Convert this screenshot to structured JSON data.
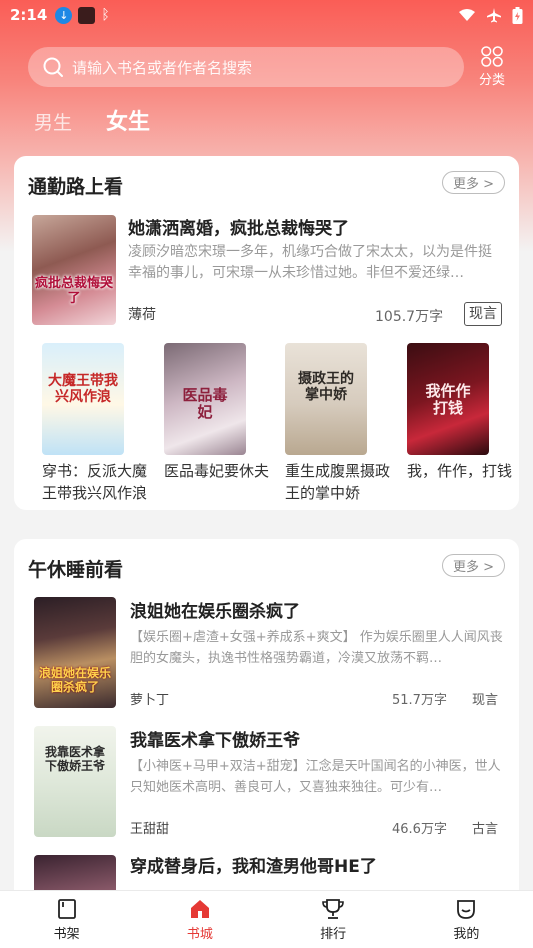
{
  "status_bar": {
    "time": "2:14"
  },
  "search": {
    "placeholder": "请输入书名或者作者名搜索"
  },
  "category": {
    "label": "分类"
  },
  "gender_tabs": [
    {
      "label": "男生"
    },
    {
      "label": "女生"
    }
  ],
  "sections": [
    {
      "title": "通勤路上看",
      "more": "更多 >",
      "featured": {
        "title": "她潇洒离婚，疯批总裁悔哭了",
        "description": "凌顾汐暗恋宋璟一多年，机缘巧合做了宋太太，以为是件挺幸福的事儿，可宋璟一从未珍惜过她。非但不爱还绿…",
        "author": "薄荷",
        "words": "105.7万字",
        "tag": "现言",
        "cover_text": "疯批总裁悔哭了"
      },
      "books": [
        {
          "title": "穿书：反派大魔王带我兴风作浪",
          "cover_text": "大魔王带我兴风作浪"
        },
        {
          "title": "医品毒妃要休夫",
          "cover_text": "医品毒妃"
        },
        {
          "title": "重生成腹黑摄政王的掌中娇",
          "cover_text": "摄政王的掌中娇"
        },
        {
          "title": "我，仵作，打钱",
          "cover_text": "我仵作打钱"
        }
      ]
    },
    {
      "title": "午休睡前看",
      "more": "更多 >",
      "books": [
        {
          "title": "浪姐她在娱乐圈杀疯了",
          "description": "【娱乐圈+虐渣+女强+养成系+爽文】 作为娱乐圈里人人闻风丧胆的女魔头，执逸书性格强势霸道，冷漠又放荡不羁…",
          "author": "萝卜丁",
          "words": "51.7万字",
          "genre": "现言",
          "cover_text": "浪姐她在娱乐圈杀疯了"
        },
        {
          "title": "我靠医术拿下傲娇王爷",
          "description": "【小神医+马甲+双洁+甜宠】江念是天叶国闻名的小神医，世人只知她医术高明、善良可人，又喜独来独往。可少有…",
          "author": "王甜甜",
          "words": "46.6万字",
          "genre": "古言",
          "cover_text": "我靠医术拿下傲娇王爷"
        },
        {
          "title": "穿成替身后，我和渣男他哥HE了",
          "description": "",
          "author": "",
          "words": "",
          "genre": "",
          "cover_text": ""
        }
      ]
    }
  ],
  "bottom_nav": [
    {
      "label": "书架",
      "icon": "bookshelf-icon"
    },
    {
      "label": "书城",
      "icon": "bookstore-icon"
    },
    {
      "label": "排行",
      "icon": "trophy-icon"
    },
    {
      "label": "我的",
      "icon": "profile-icon"
    }
  ],
  "colors": {
    "accent": "#e53935",
    "header_top": "#fa5d56"
  }
}
